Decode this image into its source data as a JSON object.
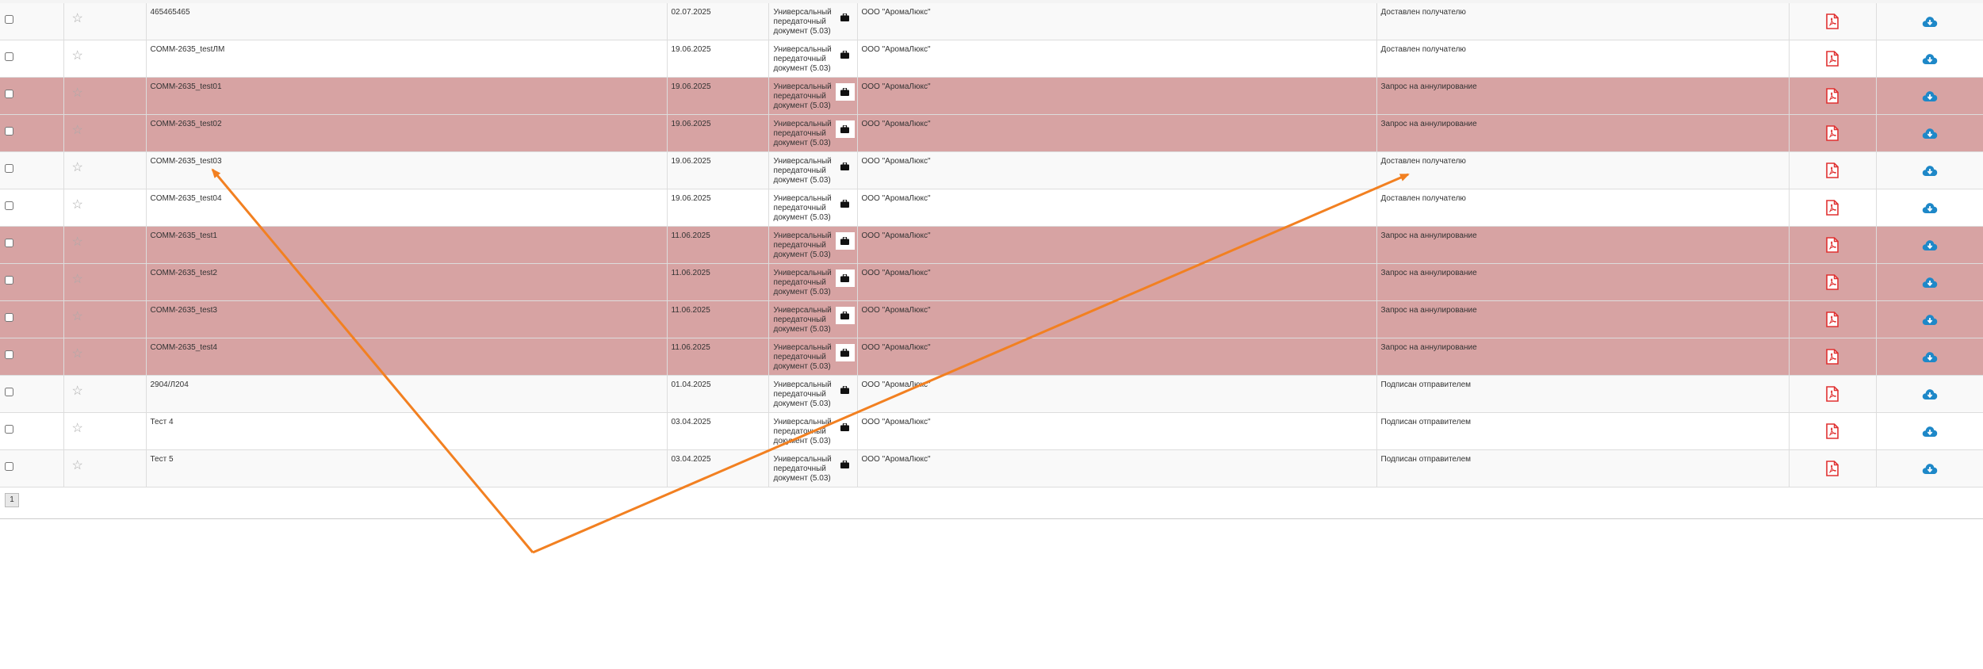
{
  "theme": {
    "annul_row_color": "#d7a3a3",
    "pdf_icon_color": "#e03131",
    "download_icon_color": "#1e88c8",
    "arrow_color": "#f28021"
  },
  "icons": {
    "favorite": "star-outline-icon",
    "type_action": "briefcase-icon",
    "pdf": "pdf-file-icon",
    "download": "cloud-download-icon"
  },
  "rows": [
    {
      "number": "465465465",
      "date": "02.07.2025",
      "type": "Универсальный передаточный документ (5.03)",
      "counterparty": "ООО \"АромаЛюкс\"",
      "status": "Доставлен получателю",
      "annul": false
    },
    {
      "number": "COMM-2635_testЛМ",
      "date": "19.06.2025",
      "type": "Универсальный передаточный документ (5.03)",
      "counterparty": "ООО \"АромаЛюкс\"",
      "status": "Доставлен получателю",
      "annul": false
    },
    {
      "number": "COMM-2635_test01",
      "date": "19.06.2025",
      "type": "Универсальный передаточный документ (5.03)",
      "counterparty": "ООО \"АромаЛюкс\"",
      "status": "Запрос на аннулирование",
      "annul": true
    },
    {
      "number": "COMM-2635_test02",
      "date": "19.06.2025",
      "type": "Универсальный передаточный документ (5.03)",
      "counterparty": "ООО \"АромаЛюкс\"",
      "status": "Запрос на аннулирование",
      "annul": true
    },
    {
      "number": "COMM-2635_test03",
      "date": "19.06.2025",
      "type": "Универсальный передаточный документ (5.03)",
      "counterparty": "ООО \"АромаЛюкс\"",
      "status": "Доставлен получателю",
      "annul": false
    },
    {
      "number": "COMM-2635_test04",
      "date": "19.06.2025",
      "type": "Универсальный передаточный документ (5.03)",
      "counterparty": "ООО \"АромаЛюкс\"",
      "status": "Доставлен получателю",
      "annul": false
    },
    {
      "number": "COMM-2635_test1",
      "date": "11.06.2025",
      "type": "Универсальный передаточный документ (5.03)",
      "counterparty": "ООО \"АромаЛюкс\"",
      "status": "Запрос на аннулирование",
      "annul": true
    },
    {
      "number": "COMM-2635_test2",
      "date": "11.06.2025",
      "type": "Универсальный передаточный документ (5.03)",
      "counterparty": "ООО \"АромаЛюкс\"",
      "status": "Запрос на аннулирование",
      "annul": true
    },
    {
      "number": "COMM-2635_test3",
      "date": "11.06.2025",
      "type": "Универсальный передаточный документ (5.03)",
      "counterparty": "ООО \"АромаЛюкс\"",
      "status": "Запрос на аннулирование",
      "annul": true
    },
    {
      "number": "COMM-2635_test4",
      "date": "11.06.2025",
      "type": "Универсальный передаточный документ (5.03)",
      "counterparty": "ООО \"АромаЛюкс\"",
      "status": "Запрос на аннулирование",
      "annul": true
    },
    {
      "number": "2904/Л204",
      "date": "01.04.2025",
      "type": "Универсальный передаточный документ (5.03)",
      "counterparty": "ООО \"АромаЛюкс\"",
      "status": "Подписан отправителем",
      "annul": false
    },
    {
      "number": "Тест 4",
      "date": "03.04.2025",
      "type": "Универсальный передаточный документ (5.03)",
      "counterparty": "ООО \"АромаЛюкс\"",
      "status": "Подписан отправителем",
      "annul": false
    },
    {
      "number": "Тест 5",
      "date": "03.04.2025",
      "type": "Универсальный передаточный документ (5.03)",
      "counterparty": "ООО \"АромаЛюкс\"",
      "status": "Подписан отправителем",
      "annul": false
    }
  ],
  "pagination": {
    "current_page": "1"
  }
}
